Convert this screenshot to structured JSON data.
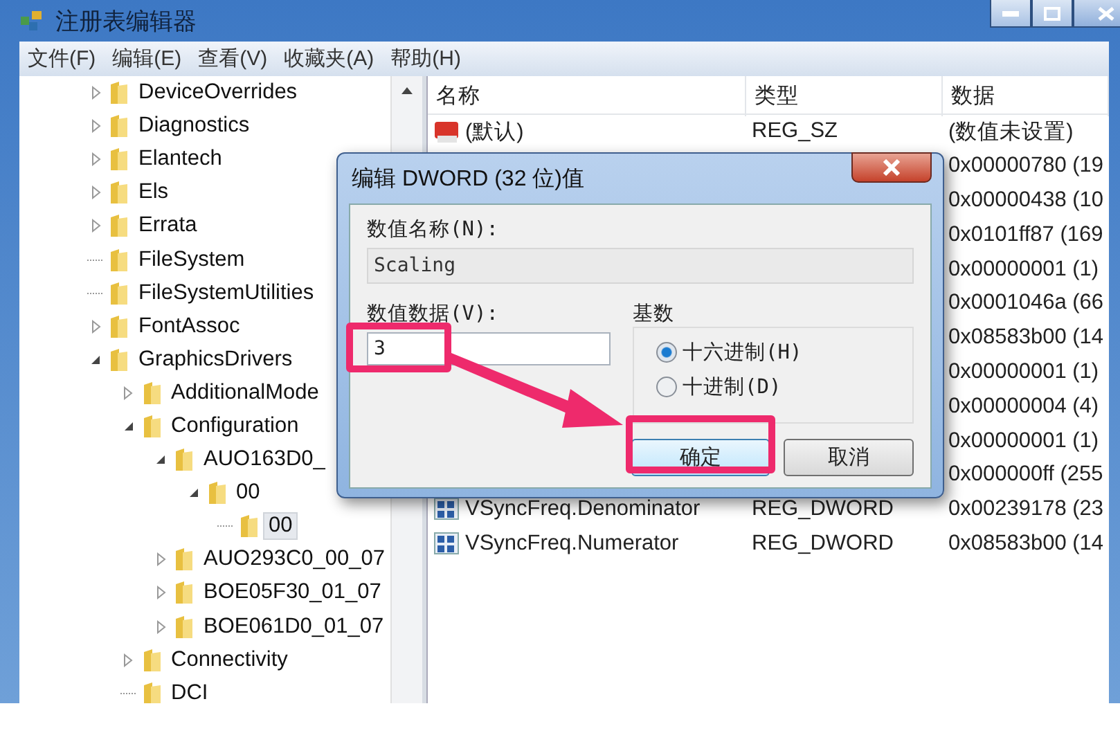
{
  "window": {
    "title": "注册表编辑器"
  },
  "menu": [
    "文件(F)",
    "编辑(E)",
    "查看(V)",
    "收藏夹(A)",
    "帮助(H)"
  ],
  "tree": [
    {
      "label": "DeviceOverrides",
      "kind": "branch",
      "expanded": false,
      "selected": false
    },
    {
      "label": "Diagnostics",
      "kind": "branch",
      "expanded": false,
      "selected": false
    },
    {
      "label": "Elantech",
      "kind": "branch",
      "expanded": false,
      "selected": false
    },
    {
      "label": "Els",
      "kind": "branch",
      "expanded": false,
      "selected": false
    },
    {
      "label": "Errata",
      "kind": "branch",
      "expanded": false,
      "selected": false
    },
    {
      "label": "FileSystem",
      "kind": "leaf",
      "selected": false
    },
    {
      "label": "FileSystemUtilities",
      "kind": "leaf",
      "selected": false
    },
    {
      "label": "FontAssoc",
      "kind": "branch",
      "expanded": false,
      "selected": false
    },
    {
      "label": "GraphicsDrivers",
      "kind": "branch",
      "expanded": true,
      "selected": false,
      "children": [
        {
          "label": "AdditionalMode",
          "kind": "branch",
          "expanded": false,
          "selected": false
        },
        {
          "label": "Configuration",
          "kind": "branch",
          "expanded": true,
          "selected": false,
          "children": [
            {
              "label": "AUO163D0_",
              "kind": "branch",
              "expanded": true,
              "selected": false,
              "children": [
                {
                  "label": "00",
                  "kind": "branch",
                  "expanded": true,
                  "selected": false,
                  "children": [
                    {
                      "label": "00",
                      "kind": "leaf",
                      "selected": true
                    }
                  ]
                }
              ]
            },
            {
              "label": "AUO293C0_00_07",
              "kind": "branch",
              "expanded": false,
              "selected": false
            },
            {
              "label": "BOE05F30_01_07",
              "kind": "branch",
              "expanded": false,
              "selected": false
            },
            {
              "label": "BOE061D0_01_07",
              "kind": "branch",
              "expanded": false,
              "selected": false
            }
          ]
        },
        {
          "label": "Connectivity",
          "kind": "branch",
          "expanded": false,
          "selected": false
        },
        {
          "label": "DCI",
          "kind": "leaf",
          "selected": false
        }
      ]
    }
  ],
  "list": {
    "columns": [
      "名称",
      "类型",
      "数据"
    ],
    "rows": [
      {
        "kind": "string",
        "name": "(默认)",
        "type": "REG_SZ",
        "data": "(数值未设置)"
      },
      {
        "data": "0x00000780 (19"
      },
      {
        "data": "0x00000438 (10"
      },
      {
        "data": "0x0101ff87 (169"
      },
      {
        "data": "0x00000001 (1)"
      },
      {
        "data": "0x0001046a (66"
      },
      {
        "data": "0x08583b00 (14"
      },
      {
        "data": "0x00000001 (1)"
      },
      {
        "data": "0x00000004 (4)"
      },
      {
        "data": "0x00000001 (1)"
      },
      {
        "data": "0x000000ff (255"
      },
      {
        "kind": "dword",
        "name": "VSyncFreq.Denominator",
        "type": "REG_DWORD",
        "data": "0x00239178 (23"
      },
      {
        "kind": "dword",
        "name": "VSyncFreq.Numerator",
        "type": "REG_DWORD",
        "data": "0x08583b00 (14"
      }
    ]
  },
  "dialog": {
    "title": "编辑 DWORD (32 位)值",
    "name_label": "数值名称(N):",
    "name_value": "Scaling",
    "data_label": "数值数据(V):",
    "data_value": "3",
    "base": {
      "title": "基数",
      "options": [
        {
          "label": "十六进制(H)",
          "selected": true
        },
        {
          "label": "十进制(D)",
          "selected": false
        }
      ]
    },
    "buttons": [
      {
        "label": "确定",
        "default": true
      },
      {
        "label": "取消",
        "default": false
      }
    ]
  }
}
